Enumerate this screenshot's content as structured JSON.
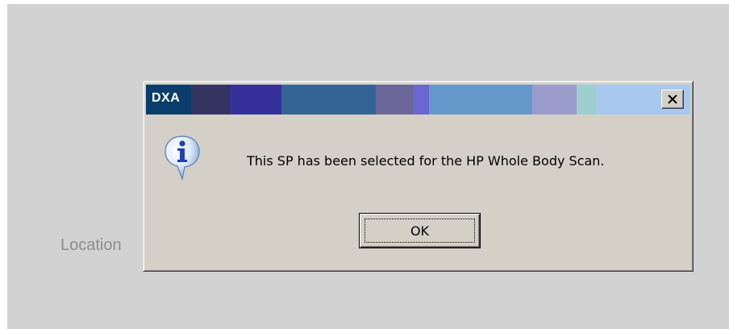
{
  "background": {
    "label": "Location"
  },
  "dialog": {
    "title": "DXA",
    "message": "This SP has been selected for the HP Whole Body Scan.",
    "ok_label": "OK",
    "close_icon": "close-icon",
    "message_icon": "information-icon",
    "title_band_colors": [
      "#0a3d6b",
      "#33345f",
      "#35309a",
      "#336495",
      "#6b6798",
      "#6a68d0",
      "#6699cb",
      "#9c9ccc",
      "#9ecfce",
      "#a8c8ee"
    ]
  }
}
